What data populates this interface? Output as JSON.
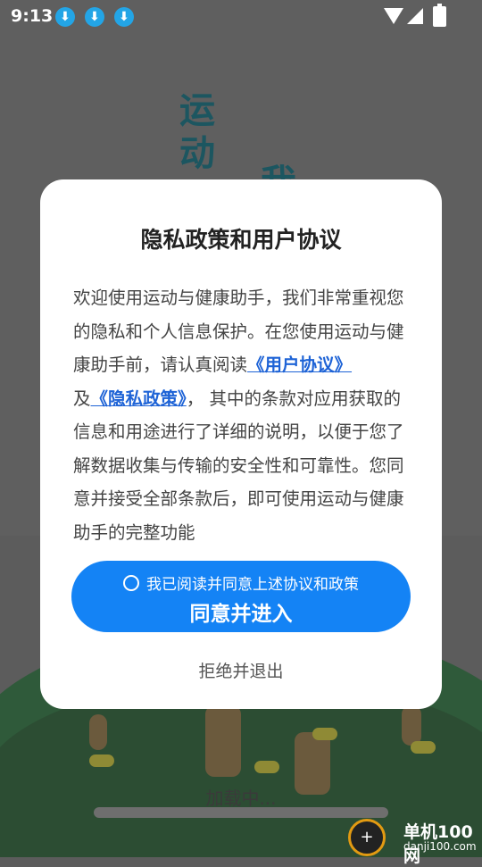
{
  "status_bar": {
    "time": "9:13",
    "download_icons": [
      "download-icon",
      "download-icon",
      "download-icon"
    ]
  },
  "background": {
    "title_part1": "运\n动",
    "title_part2": "我",
    "loading_text": "加载中..."
  },
  "dialog": {
    "title": "隐私政策和用户协议",
    "body_intro": "欢迎使用运动与健康助手，我们非常重视您的隐私和个人信息保护。在您使用运动与健康助手前，请认真阅读",
    "user_agreement_link": "《用户协议》",
    "and_word": "及",
    "privacy_policy_link": "《隐私政策》",
    "body_rest": "， 其中的条款对应用获取的信息和用途进行了详细的说明，以便于您了解数据收集与传输的安全性和可靠性。您同意并接受全部条款后，即可使用运动与健康助手的完整功能",
    "checkbox_label": "我已阅读并同意上述协议和政策",
    "agree_button": "同意并进入",
    "reject_button": "拒绝并退出"
  },
  "watermark": {
    "title": "单机100网",
    "url": "danji100.com"
  },
  "colors": {
    "primary": "#1483f5",
    "link": "#1e63d6"
  }
}
